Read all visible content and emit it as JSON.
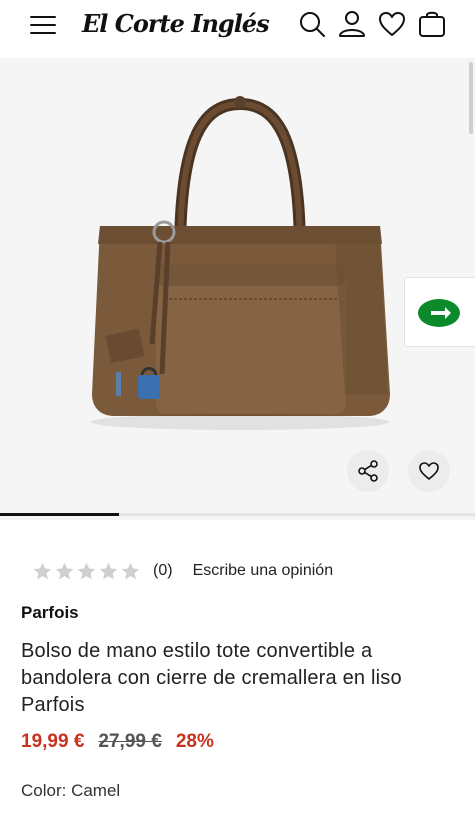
{
  "header": {
    "logo_text": "El Corte Inglés"
  },
  "gallery": {
    "progress": 0.25
  },
  "product": {
    "rating_count": "(0)",
    "review_link": "Escribe una opinión",
    "brand": "Parfois",
    "title": "Bolso de mano estilo tote convertible a bandolera con cierre de cremallera en liso Parfois",
    "price_current": "19,99 €",
    "price_original": "27,99 €",
    "discount": "28%",
    "color_label": "Color: Camel"
  },
  "colors": {
    "accent_red": "#c8321f",
    "chat_green": "#0a8a2a",
    "bag_camel": "#7a5a3a"
  }
}
